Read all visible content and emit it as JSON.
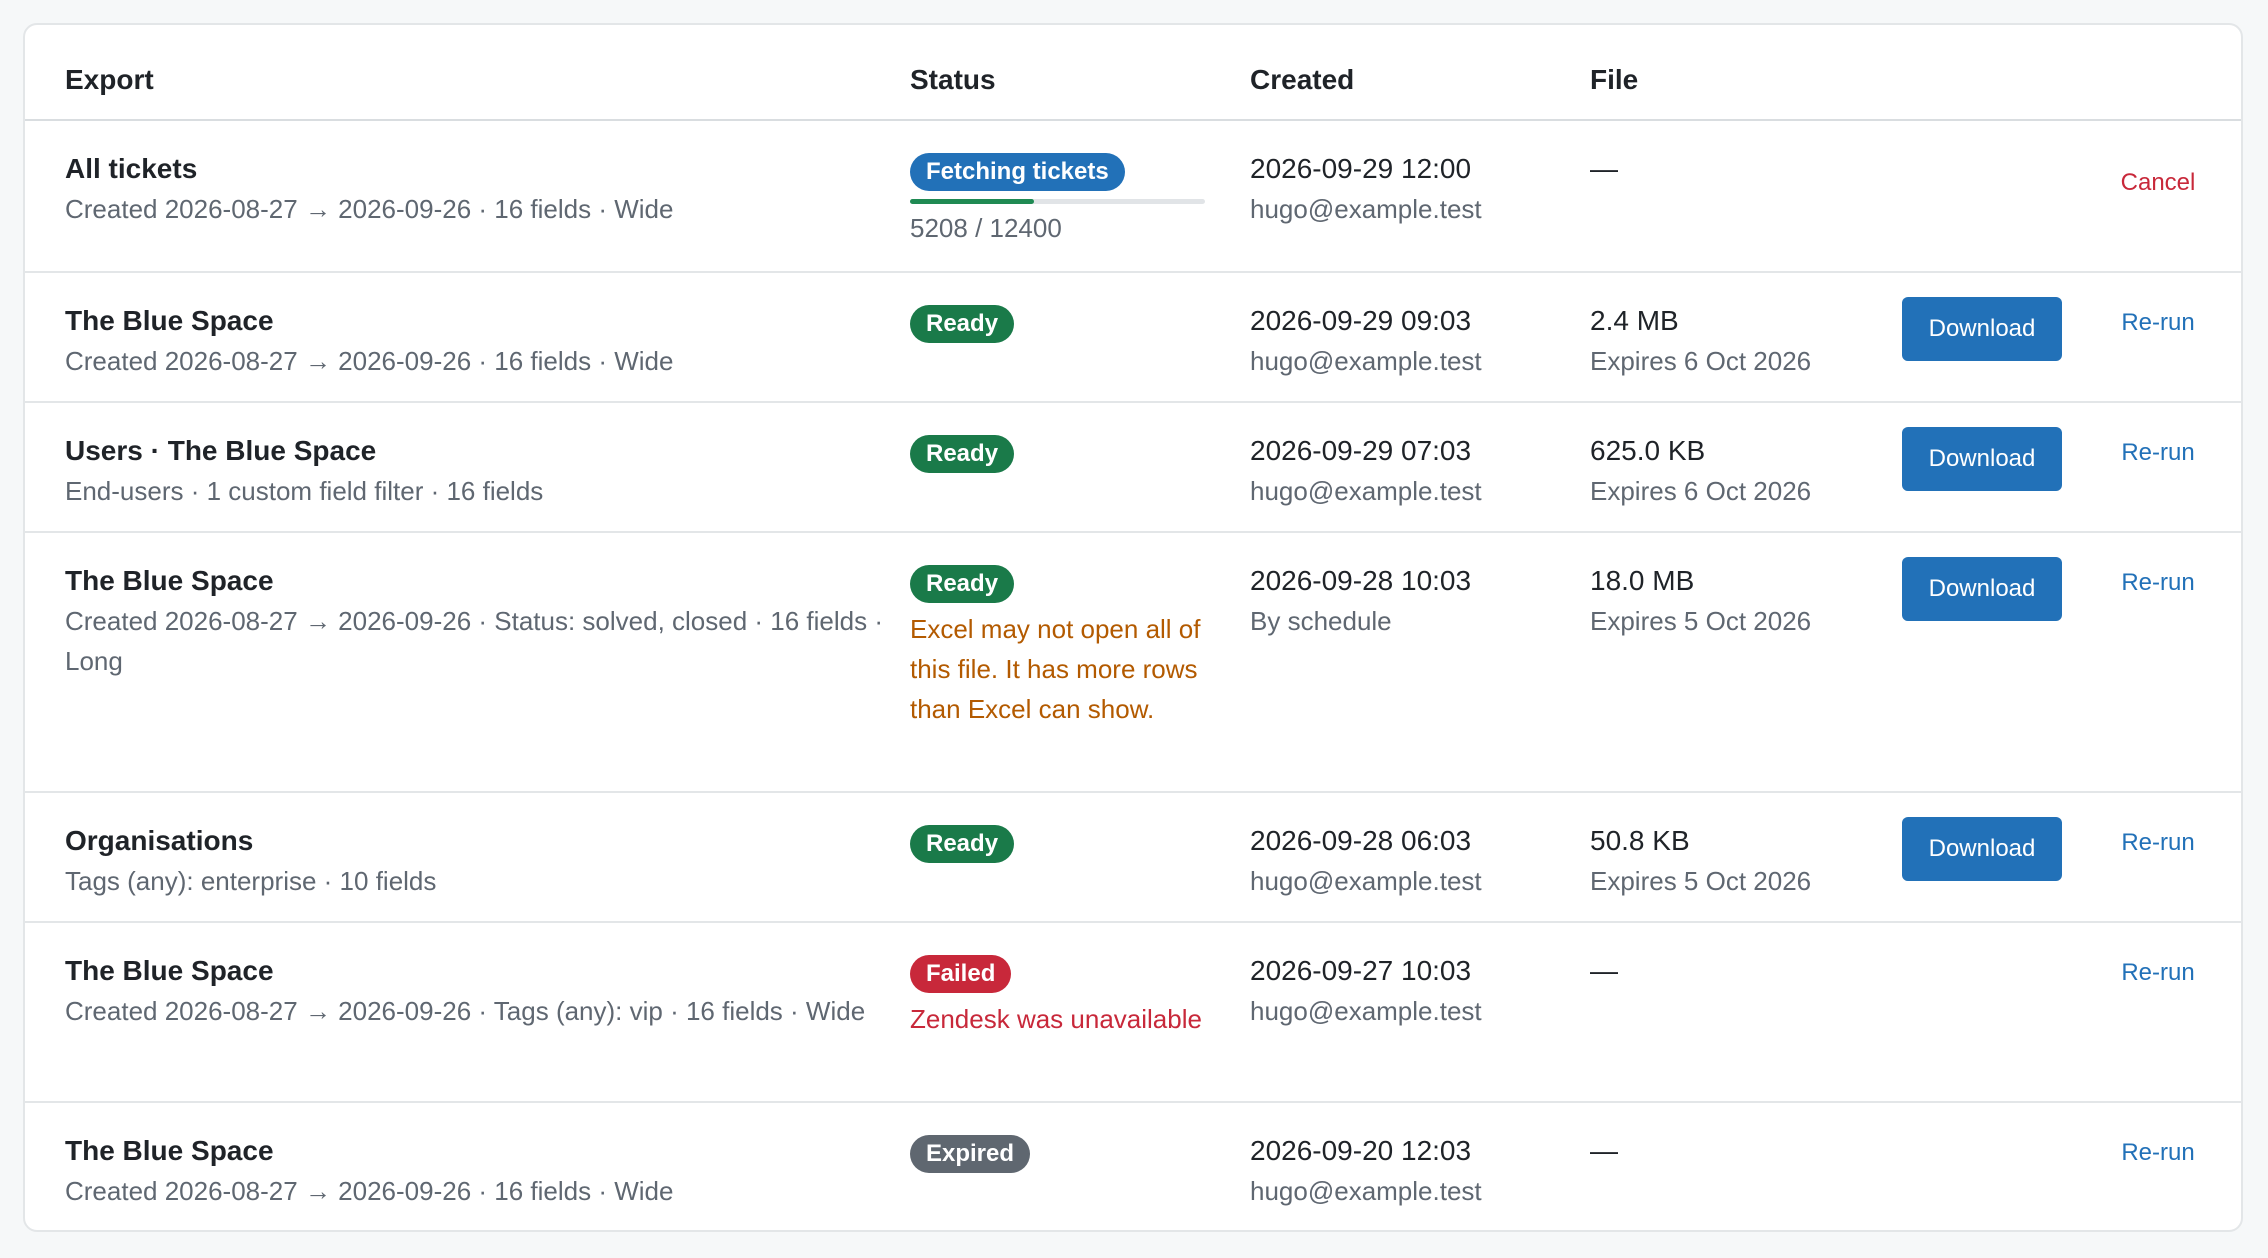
{
  "colors": {
    "primary_button": "#2271b8",
    "link": "#2271b8",
    "cancel": "#c8283a",
    "badge_running": "#2271b8",
    "badge_ready": "#1a7a49",
    "badge_failed": "#c8283a",
    "badge_expired": "#5f6770",
    "warning_text": "#b35a00",
    "error_text": "#c8283a",
    "progress_fill": "#1f8a53"
  },
  "table": {
    "headers": {
      "export": "Export",
      "status": "Status",
      "created": "Created",
      "file": "File"
    },
    "rows": [
      {
        "title": "All tickets",
        "meta": "Created 2026-08-27 → 2026-09-26 · 16 fields · Wide",
        "status": {
          "label": "Fetching tickets",
          "kind": "running"
        },
        "progress": {
          "text": "5208 / 12400",
          "done": 5208,
          "total": 12400
        },
        "created_at": "2026-09-29 12:00",
        "created_by": "hugo@example.test",
        "file_size": "—",
        "action": {
          "label": "Cancel",
          "kind": "cancel"
        }
      },
      {
        "title": "The Blue Space",
        "meta": "Created 2026-08-27 → 2026-09-26 · 16 fields · Wide",
        "status": {
          "label": "Ready",
          "kind": "ready"
        },
        "created_at": "2026-09-29 09:03",
        "created_by": "hugo@example.test",
        "file_size": "2.4 MB",
        "file_expiry": "Expires 6 Oct 2026",
        "download_label": "Download",
        "action": {
          "label": "Re-run",
          "kind": "rerun"
        }
      },
      {
        "title": "Users · The Blue Space",
        "meta": "End-users · 1 custom field filter · 16 fields",
        "status": {
          "label": "Ready",
          "kind": "ready"
        },
        "created_at": "2026-09-29 07:03",
        "created_by": "hugo@example.test",
        "file_size": "625.0 KB",
        "file_expiry": "Expires 6 Oct 2026",
        "download_label": "Download",
        "action": {
          "label": "Re-run",
          "kind": "rerun"
        }
      },
      {
        "title": "The Blue Space",
        "meta": "Created 2026-08-27 → 2026-09-26 · Status: solved, closed · 16 fields · Long",
        "status": {
          "label": "Ready",
          "kind": "ready"
        },
        "status_note": {
          "text": "Excel may not open all of this file. It has more rows than Excel can show.",
          "kind": "warning"
        },
        "created_at": "2026-09-28 10:03",
        "created_by": "By schedule",
        "file_size": "18.0 MB",
        "file_expiry": "Expires 5 Oct 2026",
        "download_label": "Download",
        "action": {
          "label": "Re-run",
          "kind": "rerun"
        }
      },
      {
        "title": "Organisations",
        "meta": "Tags (any): enterprise · 10 fields",
        "status": {
          "label": "Ready",
          "kind": "ready"
        },
        "created_at": "2026-09-28 06:03",
        "created_by": "hugo@example.test",
        "file_size": "50.8 KB",
        "file_expiry": "Expires 5 Oct 2026",
        "download_label": "Download",
        "action": {
          "label": "Re-run",
          "kind": "rerun"
        }
      },
      {
        "title": "The Blue Space",
        "meta": "Created 2026-08-27 → 2026-09-26 · Tags (any): vip · 16 fields · Wide",
        "status": {
          "label": "Failed",
          "kind": "failed"
        },
        "status_note": {
          "text": "Zendesk was unavailable",
          "kind": "error"
        },
        "created_at": "2026-09-27 10:03",
        "created_by": "hugo@example.test",
        "file_size": "—",
        "action": {
          "label": "Re-run",
          "kind": "rerun"
        }
      },
      {
        "title": "The Blue Space",
        "meta": "Created 2026-08-27 → 2026-09-26 · 16 fields · Wide",
        "status": {
          "label": "Expired",
          "kind": "expired"
        },
        "created_at": "2026-09-20 12:03",
        "created_by": "hugo@example.test",
        "file_size": "—",
        "action": {
          "label": "Re-run",
          "kind": "rerun"
        }
      }
    ]
  }
}
